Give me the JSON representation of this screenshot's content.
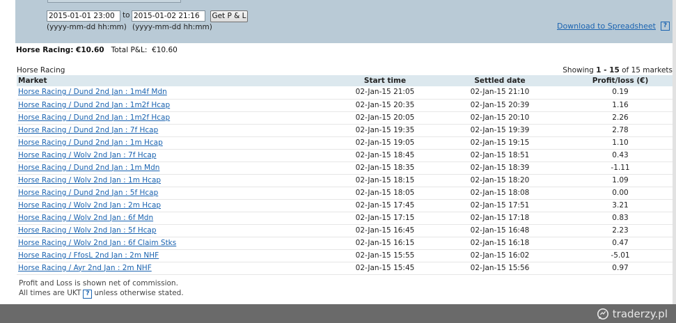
{
  "filter": {
    "from_value": "2015-01-01 23:00",
    "to_label": "to",
    "to_value": "2015-01-02 21:16",
    "from_hint": "(yyyy-mm-dd hh:mm)",
    "to_hint": "(yyyy-mm-dd hh:mm)",
    "button_label": "Get P & L",
    "download_label": "Download to Spreadsheet",
    "help_glyph": "?"
  },
  "summary": {
    "sport_total": "Horse Racing: €10.60",
    "total_label": "Total P&L:",
    "total_value": "€10.60"
  },
  "section": {
    "label": "Horse Racing",
    "showing_prefix": "Showing",
    "showing_range": "1 - 15",
    "showing_of": "of 15 markets"
  },
  "table": {
    "headers": {
      "market": "Market",
      "start": "Start time",
      "settled": "Settled date",
      "pl": "Profit/loss (€)"
    },
    "rows": [
      {
        "market": "Horse Racing / Dund 2nd Jan : 1m4f Mdn",
        "start": "02-Jan-15 21:05",
        "settled": "02-Jan-15 21:10",
        "pl": "0.19"
      },
      {
        "market": "Horse Racing / Dund 2nd Jan : 1m2f Hcap",
        "start": "02-Jan-15 20:35",
        "settled": "02-Jan-15 20:39",
        "pl": "1.16"
      },
      {
        "market": "Horse Racing / Dund 2nd Jan : 1m2f Hcap",
        "start": "02-Jan-15 20:05",
        "settled": "02-Jan-15 20:10",
        "pl": "2.26"
      },
      {
        "market": "Horse Racing / Dund 2nd Jan : 7f Hcap",
        "start": "02-Jan-15 19:35",
        "settled": "02-Jan-15 19:39",
        "pl": "2.78"
      },
      {
        "market": "Horse Racing / Dund 2nd Jan : 1m Hcap",
        "start": "02-Jan-15 19:05",
        "settled": "02-Jan-15 19:15",
        "pl": "1.10"
      },
      {
        "market": "Horse Racing / Wolv 2nd Jan : 7f Hcap",
        "start": "02-Jan-15 18:45",
        "settled": "02-Jan-15 18:51",
        "pl": "0.43"
      },
      {
        "market": "Horse Racing / Dund 2nd Jan : 1m Mdn",
        "start": "02-Jan-15 18:35",
        "settled": "02-Jan-15 18:39",
        "pl": "-1.11"
      },
      {
        "market": "Horse Racing / Wolv 2nd Jan : 1m Hcap",
        "start": "02-Jan-15 18:15",
        "settled": "02-Jan-15 18:20",
        "pl": "1.09"
      },
      {
        "market": "Horse Racing / Dund 2nd Jan : 5f Hcap",
        "start": "02-Jan-15 18:05",
        "settled": "02-Jan-15 18:08",
        "pl": "0.00"
      },
      {
        "market": "Horse Racing / Wolv 2nd Jan : 2m Hcap",
        "start": "02-Jan-15 17:45",
        "settled": "02-Jan-15 17:51",
        "pl": "3.21"
      },
      {
        "market": "Horse Racing / Wolv 2nd Jan : 6f Mdn",
        "start": "02-Jan-15 17:15",
        "settled": "02-Jan-15 17:18",
        "pl": "0.83"
      },
      {
        "market": "Horse Racing / Wolv 2nd Jan : 5f Hcap",
        "start": "02-Jan-15 16:45",
        "settled": "02-Jan-15 16:48",
        "pl": "2.23"
      },
      {
        "market": "Horse Racing / Wolv 2nd Jan : 6f Claim Stks",
        "start": "02-Jan-15 16:15",
        "settled": "02-Jan-15 16:18",
        "pl": "0.47"
      },
      {
        "market": "Horse Racing / FfosL 2nd Jan : 2m NHF",
        "start": "02-Jan-15 15:55",
        "settled": "02-Jan-15 16:02",
        "pl": "-5.01"
      },
      {
        "market": "Horse Racing / Ayr 2nd Jan : 2m NHF",
        "start": "02-Jan-15 15:45",
        "settled": "02-Jan-15 15:56",
        "pl": "0.97"
      }
    ]
  },
  "notes": {
    "line1": "Profit and Loss is shown net of commission.",
    "line2_prefix": "All times are UKT",
    "line2_suffix": "unless otherwise stated."
  },
  "watermark": {
    "text": "traderzy.pl"
  },
  "colors": {
    "panel": "#b9cad6",
    "header_row": "#dce8ee",
    "link": "#1a63b0",
    "bottom_bar": "#6a6a6a"
  }
}
